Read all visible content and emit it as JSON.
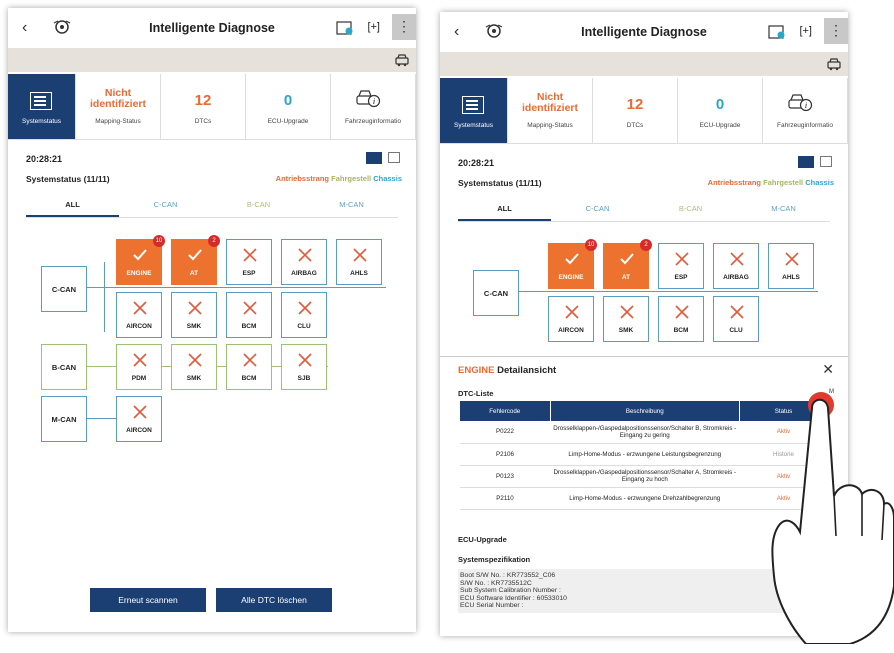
{
  "app": {
    "title": "Intelligente Diagnose",
    "back": "‹",
    "menu": "⋮",
    "plus_icon": "[+]"
  },
  "tiles": {
    "sys_label": "Systemstatus",
    "mapping_value": "Nicht identifiziert",
    "mapping_label": "Mapping-Status",
    "dtc_value": "12",
    "dtc_label": "DTCs",
    "ecu_value": "0",
    "ecu_label": "ECU-Upgrade",
    "veh_label": "Fahrzeuginformatio"
  },
  "tiles_right": {
    "veh_label": "Fahrzeuginformatio"
  },
  "time": "20:28:21",
  "status_label": "Systemstatus (11/11)",
  "legend": {
    "a": "Antriebsstrang",
    "f": "Fahrgestell",
    "c": "Chassis"
  },
  "subtabs": [
    "ALL",
    "C-CAN",
    "B-CAN",
    "M-CAN"
  ],
  "network": {
    "ccan": "C-CAN",
    "bcan": "B-CAN",
    "mcan": "M-CAN",
    "row1": [
      "ENGINE",
      "AT",
      "ESP",
      "AIRBAG",
      "AHLS"
    ],
    "row2": [
      "AIRCON",
      "SMK",
      "BCM",
      "CLU"
    ],
    "row3": [
      "PDM",
      "SMK",
      "BCM",
      "SJB"
    ],
    "row4": [
      "AIRCON"
    ],
    "badges": [
      "10",
      "2"
    ]
  },
  "buttons": {
    "rescan": "Erneut scannen",
    "clear": "Alle DTC löschen"
  },
  "detail": {
    "engine": "ENGINE",
    "title": "Detailansicht",
    "close": "✕",
    "dtc_list": "DTC-Liste",
    "more": "M",
    "headers": [
      "Fehlercode",
      "Beschreibung",
      "Status"
    ],
    "rows": [
      {
        "code": "P0222",
        "desc": "Drosselklappen-/Gaspedalpositionssensor/Schalter B, Stromkreis - Eingang zu gering",
        "status": "Aktiv",
        "active": true
      },
      {
        "code": "P2106",
        "desc": "Limp-Home-Modus - erzwungene Leistungsbegrenzung",
        "status": "Historie",
        "active": false
      },
      {
        "code": "P0123",
        "desc": "Drosselklappen-/Gaspedalpositionssensor/Schalter A, Stromkreis - Eingang zu hoch",
        "status": "Aktiv",
        "active": true
      },
      {
        "code": "P2110",
        "desc": "Limp-Home-Modus - erzwungene Drehzahlbegrenzung",
        "status": "Aktiv",
        "active": true
      }
    ],
    "ecu_upgrade": "ECU-Upgrade",
    "spec_title": "Systemspezifikation",
    "spec_lines": [
      "Boot S/W No. : KR773552_C06",
      "S/W No. : KR7735512C",
      "Sub System Calibration Number :",
      "ECU Software Identifier : 60533010",
      "ECU Serial Number :"
    ]
  },
  "colors": {
    "primary": "#1c3f73",
    "error": "#ed7230",
    "ccan": "#5c9cc4",
    "bcan": "#9cc274",
    "badge": "#d92a2a"
  }
}
